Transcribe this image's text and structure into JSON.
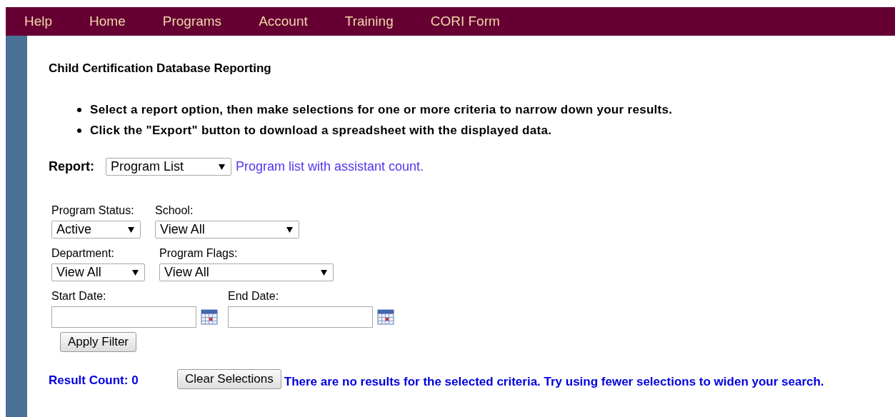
{
  "nav": [
    "Help",
    "Home",
    "Programs",
    "Account",
    "Training",
    "CORI Form"
  ],
  "title": "Child Certification Database Reporting",
  "instructions": [
    "Select a report option, then make selections for one or more criteria to narrow down your results.",
    "Click the \"Export\" button to download a spreadsheet with the displayed data."
  ],
  "report": {
    "label": "Report:",
    "value": "Program List",
    "description": "Program list with assistant count."
  },
  "filters": [
    [
      {
        "label": "Program Status:",
        "value": "Active"
      },
      {
        "label": "School:",
        "value": "View All"
      }
    ],
    [
      {
        "label": "Department:",
        "value": "View All"
      },
      {
        "label": "Program Flags:",
        "value": "View All"
      }
    ]
  ],
  "dates": [
    {
      "label": "Start Date:"
    },
    {
      "label": "End Date:"
    }
  ],
  "apply_button": "Apply Filter",
  "result_count": "Result Count: 0",
  "clear_button": "Clear Selections",
  "message": "There are no results for the selected criteria. Try using fewer selections to widen your search."
}
